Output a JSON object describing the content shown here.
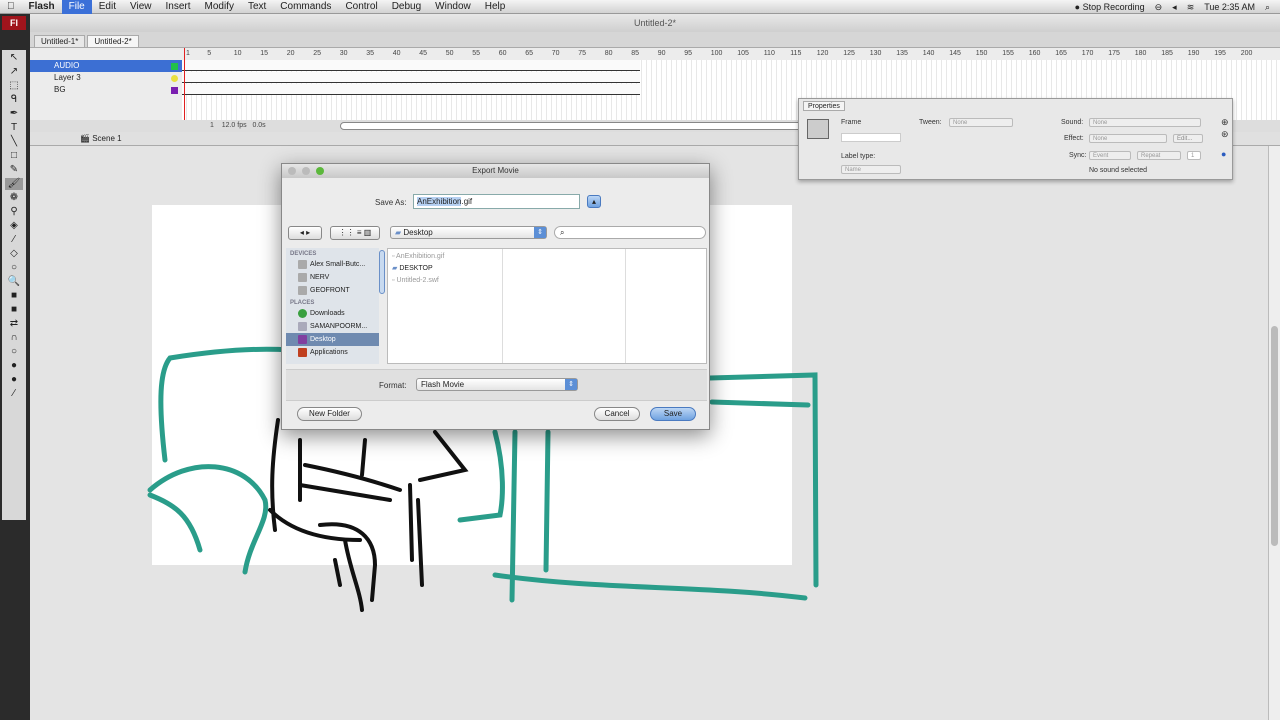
{
  "menubar": {
    "app": "Flash",
    "items": [
      "File",
      "Edit",
      "View",
      "Insert",
      "Modify",
      "Text",
      "Commands",
      "Control",
      "Debug",
      "Window",
      "Help"
    ],
    "selected": "File",
    "status": {
      "recording": "Stop Recording",
      "clock": "Tue 2:35 AM"
    }
  },
  "window": {
    "title": "Untitled-2*"
  },
  "tools": {
    "logo": "Fl"
  },
  "doc_tabs": [
    {
      "label": "Untitled-1*"
    },
    {
      "label": "Untitled-2*"
    }
  ],
  "timeline": {
    "frame_ticks": [
      "1",
      "5",
      "10",
      "15",
      "20",
      "25",
      "30",
      "35",
      "40",
      "45",
      "50",
      "55",
      "60",
      "65",
      "70",
      "75",
      "80",
      "85",
      "90",
      "95",
      "100",
      "105",
      "110",
      "115",
      "120",
      "125",
      "130",
      "135",
      "140",
      "145",
      "150",
      "155",
      "160",
      "165",
      "170",
      "175",
      "180",
      "185",
      "190",
      "195",
      "200"
    ],
    "layers": [
      {
        "name": "AUDIO",
        "color": "#22c04a",
        "selected": true
      },
      {
        "name": "Layer 3",
        "color": "#e8e040"
      },
      {
        "name": "BG",
        "color": "#7a1fb0"
      }
    ],
    "current_frame": "1",
    "fps": "12.0 fps",
    "time": "0.0s"
  },
  "scene": {
    "label": "Scene 1"
  },
  "properties": {
    "tab": "Properties",
    "frame_label": "Frame",
    "label_type_label": "Label type:",
    "label_type": "Name",
    "tween_label": "Tween:",
    "tween": "None",
    "sound_label": "Sound:",
    "sound": "None",
    "effect_label": "Effect:",
    "effect": "None",
    "edit_button": "Edit...",
    "sync_label": "Sync:",
    "sync": "Event",
    "repeat": "Repeat",
    "repeat_count": "1",
    "status": "No sound selected"
  },
  "dialog": {
    "title": "Export Movie",
    "save_as_label": "Save As:",
    "filename_selected": "AnExhibition",
    "filename_rest": ".gif",
    "location": "Desktop",
    "search_placeholder": "",
    "sidebar": {
      "devices_header": "DEVICES",
      "devices": [
        "Alex Small-Butc...",
        "NERV",
        "GEOFRONT"
      ],
      "places_header": "PLACES",
      "places": [
        "Downloads",
        "SAMANPOORM...",
        "Desktop",
        "Applications"
      ],
      "selected": "Desktop"
    },
    "files": [
      {
        "name": "AnExhibition.gif",
        "dim": true
      },
      {
        "name": "DESKTOP",
        "folder": true
      },
      {
        "name": "Untitled-2.swf",
        "dim": true
      }
    ],
    "format_label": "Format:",
    "format": "Flash Movie",
    "new_folder": "New Folder",
    "cancel": "Cancel",
    "save": "Save"
  },
  "colors": {
    "teal_stroke": "#2a9d8a",
    "selection": "#3b70d8",
    "ink": "#111111"
  }
}
